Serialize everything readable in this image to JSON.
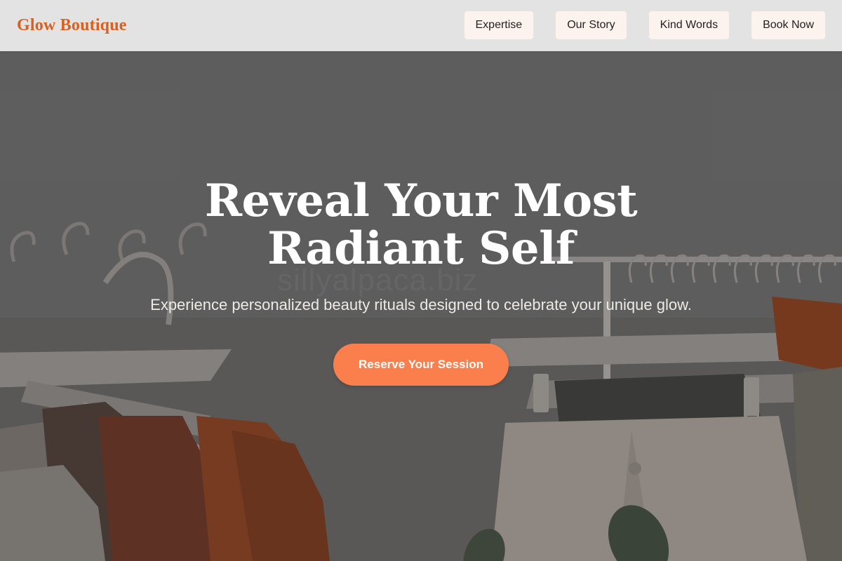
{
  "brand": {
    "name": "Glow Boutique",
    "color": "#d9601e"
  },
  "nav": {
    "items": [
      {
        "label": "Expertise"
      },
      {
        "label": "Our Story"
      },
      {
        "label": "Kind Words"
      },
      {
        "label": "Book Now"
      }
    ]
  },
  "hero": {
    "title": "Reveal Your Most Radiant Self",
    "subtitle": "Experience personalized beauty rituals designed to celebrate your unique glow.",
    "cta_label": "Reserve Your Session",
    "cta_color": "#fb7f4d",
    "background_image": "clothing-rack-photo",
    "watermark_text": "sillyalpaca.biz"
  }
}
